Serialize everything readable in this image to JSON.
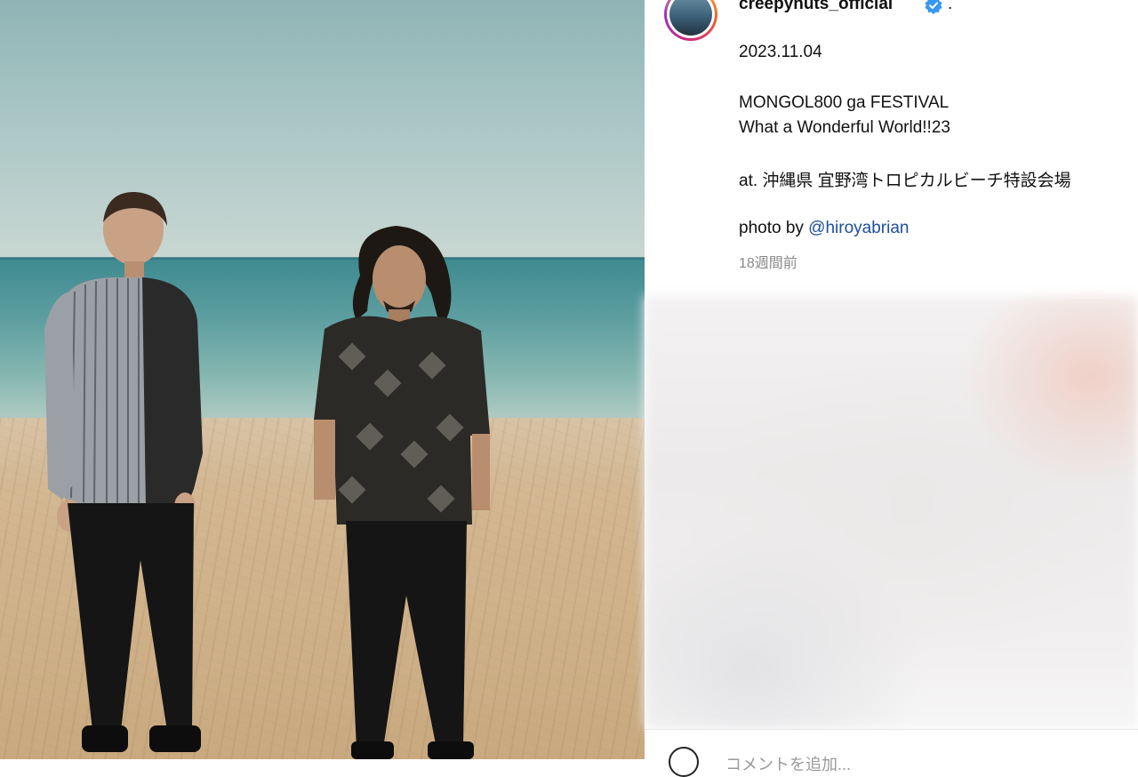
{
  "post": {
    "username": "creepyhuts_official",
    "separator": ".",
    "date": "2023.11.04",
    "event_line1": "MONGOL800 ga FESTIVAL",
    "event_line2": "What a Wonderful World!!23",
    "location": "at. 沖縄県 宜野湾トロピカルビーチ特設会場",
    "photo_credit_prefix": "photo by ",
    "photo_credit_handle": "@hiroyabrian",
    "time_ago": "18週間前"
  },
  "comment": {
    "placeholder": "コメントを追加..."
  },
  "icons": {
    "verified": "verified-badge-icon",
    "comment": "emoji-icon"
  },
  "colors": {
    "link": "#1e4f9a",
    "verified": "#3897f0"
  }
}
